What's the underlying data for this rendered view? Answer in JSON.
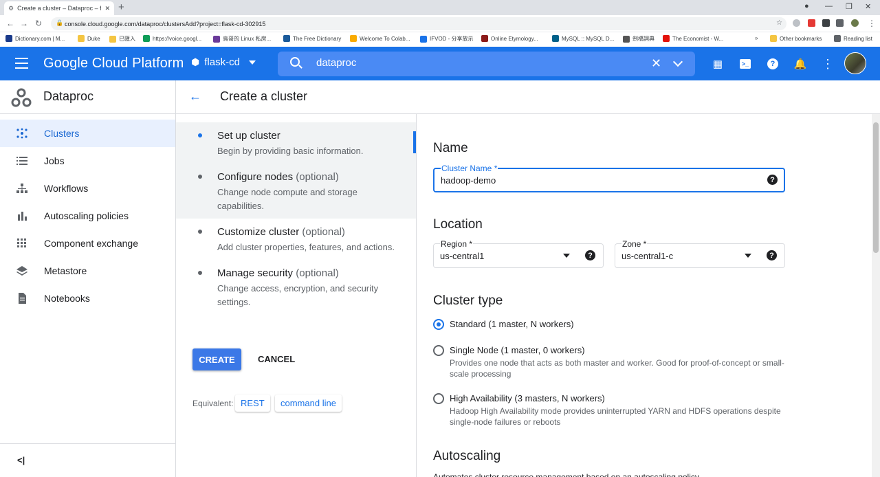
{
  "browser": {
    "tab_title": "Create a cluster – Dataproc – flas",
    "new_tab": "+",
    "url": "console.cloud.google.com/dataproc/clustersAdd?project=flask-cd-302915",
    "bookmarks": [
      {
        "label": "Dictionary.com | M...",
        "color": "#1a3a8a"
      },
      {
        "label": "Duke",
        "color": "#f4c542"
      },
      {
        "label": "已匯入",
        "color": "#f4c542"
      },
      {
        "label": "https://voice.googl...",
        "color": "#0f9d58"
      },
      {
        "label": "鳥哥的 Linux 私房...",
        "color": "#6a3a9a"
      },
      {
        "label": "The Free Dictionary",
        "color": "#1a5a9a"
      },
      {
        "label": "Welcome To Colab...",
        "color": "#f9ab00"
      },
      {
        "label": "IFVOD - 分享放示",
        "color": "#1a73e8"
      },
      {
        "label": "Online Etymology...",
        "color": "#8b1a1a"
      },
      {
        "label": "MySQL :: MySQL D...",
        "color": "#00618a"
      },
      {
        "label": "劍橋詞典",
        "color": "#555555"
      },
      {
        "label": "The Economist - W...",
        "color": "#e3120b"
      }
    ],
    "other_bookmarks": "Other bookmarks",
    "reading_list": "Reading list"
  },
  "header": {
    "brand": "Google Cloud Platform",
    "project": "flask-cd",
    "search_value": "dataproc"
  },
  "product": {
    "name": "Dataproc",
    "page_title": "Create a cluster"
  },
  "sidebar": {
    "items": [
      {
        "label": "Clusters",
        "active": true
      },
      {
        "label": "Jobs"
      },
      {
        "label": "Workflows"
      },
      {
        "label": "Autoscaling policies"
      },
      {
        "label": "Component exchange"
      },
      {
        "label": "Metastore"
      },
      {
        "label": "Notebooks"
      }
    ],
    "collapse": "<|"
  },
  "stepper": {
    "steps": [
      {
        "title": "Set up cluster",
        "optional": "",
        "desc": "Begin by providing basic information."
      },
      {
        "title": "Configure nodes",
        "optional": "(optional)",
        "desc": "Change node compute and storage capabilities."
      },
      {
        "title": "Customize cluster",
        "optional": "(optional)",
        "desc": "Add cluster properties, features, and actions."
      },
      {
        "title": "Manage security",
        "optional": "(optional)",
        "desc": "Change access, encryption, and security settings."
      }
    ],
    "create": "CREATE",
    "cancel": "CANCEL",
    "equivalent": "Equivalent:",
    "rest": "REST",
    "command_line": "command line"
  },
  "form": {
    "name_heading": "Name",
    "cluster_name_label": "Cluster Name *",
    "cluster_name_value": "hadoop-demo",
    "location_heading": "Location",
    "region_label": "Region *",
    "region_value": "us-central1",
    "zone_label": "Zone *",
    "zone_value": "us-central1-c",
    "cluster_type_heading": "Cluster type",
    "types": [
      {
        "label": "Standard (1 master, N workers)",
        "desc": "",
        "selected": true
      },
      {
        "label": "Single Node (1 master, 0 workers)",
        "desc": "Provides one node that acts as both master and worker. Good for proof-of-concept or small-scale processing",
        "selected": false
      },
      {
        "label": "High Availability (3 masters, N workers)",
        "desc": "Hadoop High Availability mode provides uninterrupted YARN and HDFS operations despite single-node failures or reboots",
        "selected": false
      }
    ],
    "autoscaling_heading": "Autoscaling",
    "autoscaling_desc": "Automates cluster resource management based on an autoscaling policy"
  },
  "colors": {
    "accent": "#1a73e8",
    "header_bg": "#1a73e8",
    "active_nav_bg": "#e8f0fe"
  }
}
